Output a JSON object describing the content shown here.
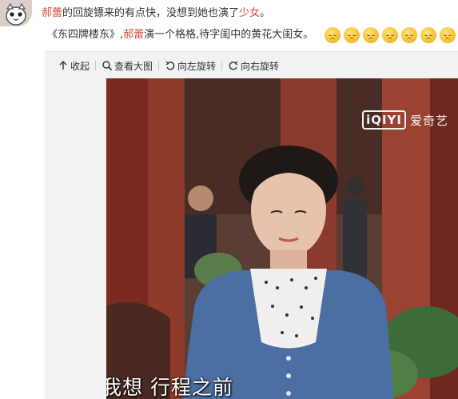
{
  "post": {
    "author_tag": "郝蕾",
    "line1_text_a": "的回旋镖来的有点快，没想到她也演了",
    "line1_highlight": "少女",
    "line1_text_b": "。",
    "line2_prefix": "《东四牌楼东》,",
    "line2_author_tag": "郝蕾",
    "line2_text": "演一个格格,待字闺中的黄花大闺女。",
    "emoji_icons": [
      "smirk-emoji",
      "smirk-emoji",
      "smirk-emoji",
      "smirk-emoji",
      "smirk-emoji",
      "smirk-emoji",
      "smirk-emoji"
    ]
  },
  "toolbar": {
    "collapse_label": "收起",
    "view_large_label": "查看大图",
    "rotate_left_label": "向左旋转",
    "rotate_right_label": "向右旋转"
  },
  "image": {
    "watermark_logo": "iQIYI",
    "watermark_text": "爱奇艺",
    "subtitle": "我想 行程之前"
  },
  "colors": {
    "highlight": "#d34b3f",
    "toolbar_bg": "#f2f2f2"
  }
}
